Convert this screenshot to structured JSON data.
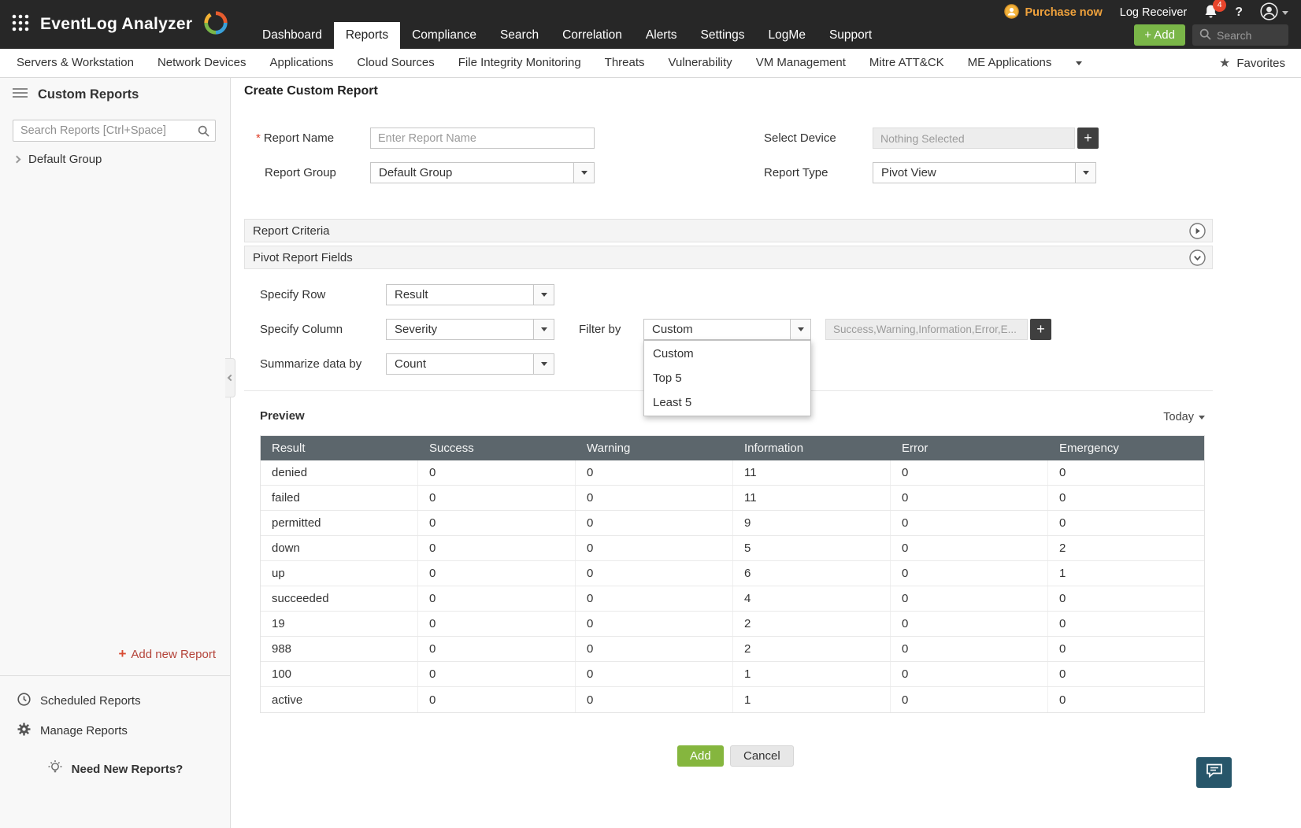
{
  "topbar": {
    "brand": "EventLog Analyzer",
    "nav": [
      "Dashboard",
      "Reports",
      "Compliance",
      "Search",
      "Correlation",
      "Alerts",
      "Settings",
      "LogMe",
      "Support"
    ],
    "active_nav": "Reports",
    "purchase_label": "Purchase now",
    "log_receiver_label": "Log Receiver",
    "notification_count": "4",
    "help_label": "?",
    "add_label": "+ Add",
    "search_placeholder": "Search"
  },
  "subnav": {
    "items": [
      "Servers & Workstation",
      "Network Devices",
      "Applications",
      "Cloud Sources",
      "File Integrity Monitoring",
      "Threats",
      "Vulnerability",
      "VM Management",
      "Mitre ATT&CK",
      "ME Applications"
    ],
    "favorites_label": "Favorites"
  },
  "sidebar": {
    "title": "Custom Reports",
    "search_placeholder": "Search Reports [Ctrl+Space]",
    "group_label": "Default Group",
    "add_new_report_label": "Add new Report",
    "scheduled_reports_label": "Scheduled Reports",
    "manage_reports_label": "Manage Reports",
    "need_new_reports_label": "Need New Reports?"
  },
  "main": {
    "title": "Create Custom Report",
    "required_marker": "*",
    "form": {
      "report_name_label": "Report Name",
      "report_name_placeholder": "Enter Report Name",
      "report_group_label": "Report Group",
      "report_group_value": "Default Group",
      "select_device_label": "Select Device",
      "select_device_value": "Nothing Selected",
      "report_type_label": "Report Type",
      "report_type_value": "Pivot View"
    },
    "panels": {
      "report_criteria_label": "Report Criteria",
      "pivot_report_fields_label": "Pivot Report Fields"
    },
    "pivot": {
      "specify_row_label": "Specify Row",
      "specify_row_value": "Result",
      "specify_column_label": "Specify Column",
      "specify_column_value": "Severity",
      "filter_by_label": "Filter by",
      "filter_by_value": "Custom",
      "filter_options": [
        "Custom",
        "Top 5",
        "Least 5"
      ],
      "filter_values_text": "Success,Warning,Information,Error,E...",
      "summarize_label": "Summarize data by",
      "summarize_value": "Count"
    },
    "preview": {
      "title": "Preview",
      "date_range": "Today"
    },
    "table": {
      "columns": [
        "Result",
        "Success",
        "Warning",
        "Information",
        "Error",
        "Emergency"
      ],
      "rows": [
        [
          "denied",
          "0",
          "0",
          "11",
          "0",
          "0"
        ],
        [
          "failed",
          "0",
          "0",
          "11",
          "0",
          "0"
        ],
        [
          "permitted",
          "0",
          "0",
          "9",
          "0",
          "0"
        ],
        [
          "down",
          "0",
          "0",
          "5",
          "0",
          "2"
        ],
        [
          "up",
          "0",
          "0",
          "6",
          "0",
          "1"
        ],
        [
          "succeeded",
          "0",
          "0",
          "4",
          "0",
          "0"
        ],
        [
          "19",
          "0",
          "0",
          "2",
          "0",
          "0"
        ],
        [
          "988",
          "0",
          "0",
          "2",
          "0",
          "0"
        ],
        [
          "100",
          "0",
          "0",
          "1",
          "0",
          "0"
        ],
        [
          "active",
          "0",
          "0",
          "1",
          "0",
          "0"
        ]
      ]
    },
    "buttons": {
      "add": "Add",
      "cancel": "Cancel"
    }
  },
  "icons": {
    "plus": "+",
    "star": "★"
  },
  "colors": {
    "topbar_bg": "#272727",
    "accent_green": "#7ab648",
    "purchase_orange": "#f0a23c",
    "badge_red": "#e8452c",
    "table_header_bg": "#5c666c",
    "chat_bg": "#27566a"
  }
}
